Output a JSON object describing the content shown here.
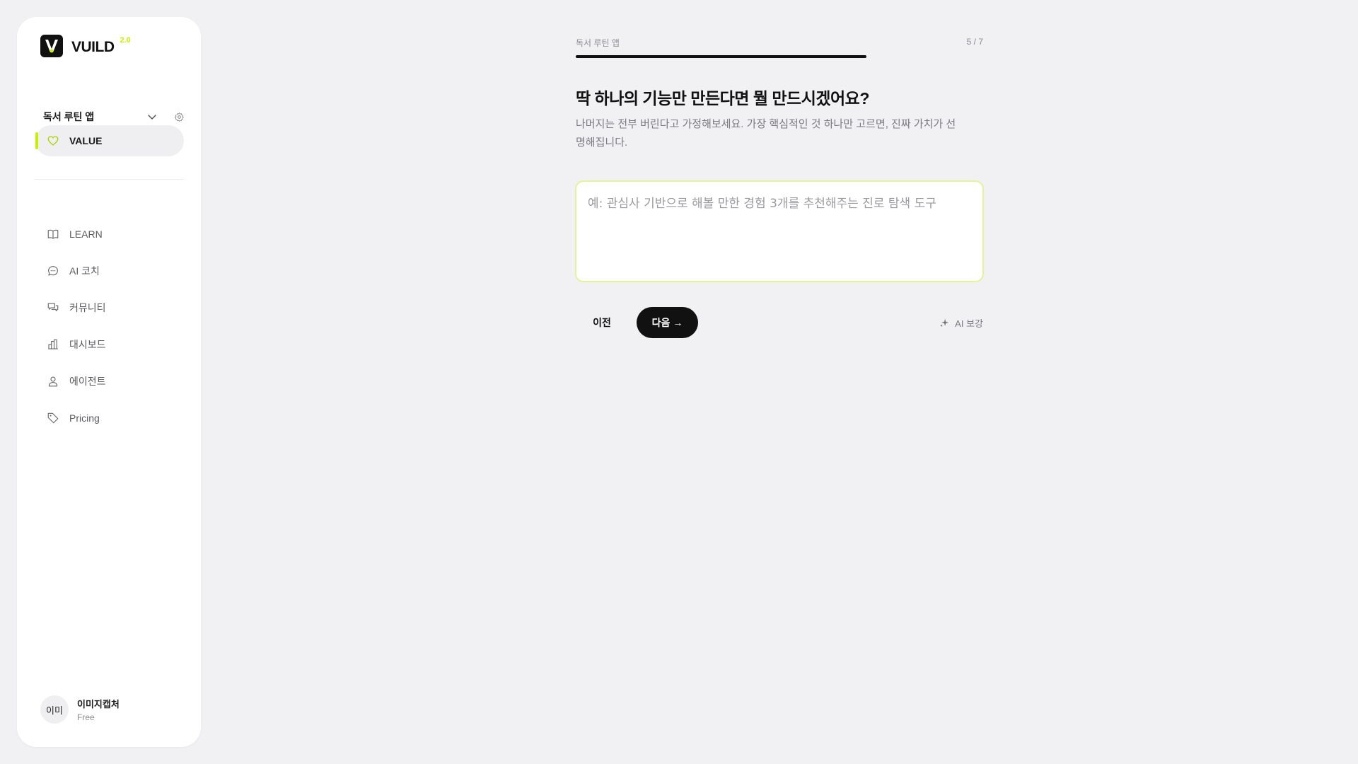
{
  "colors": {
    "accent": "#c8f000",
    "background": "#f1f1f3",
    "primary_button": "#111111"
  },
  "sidebar": {
    "logo_text": "VUILD",
    "version": "2.0",
    "project": {
      "name": "독서 루틴 앱",
      "chevron_icon": "chevron-down-icon",
      "settings_icon": "gear-icon"
    },
    "active_item": {
      "label": "VALUE",
      "icon": "heart-icon"
    },
    "items": [
      {
        "label": "LEARN",
        "icon": "book-icon"
      },
      {
        "label": "AI 코치",
        "icon": "chat-bubble-icon"
      },
      {
        "label": "커뮤니티",
        "icon": "community-chat-icon"
      },
      {
        "label": "대시보드",
        "icon": "bar-chart-icon"
      },
      {
        "label": "에이전트",
        "icon": "person-icon"
      },
      {
        "label": "Pricing",
        "icon": "tag-icon"
      }
    ],
    "user": {
      "avatar_text": "이미",
      "name": "이미지캡처",
      "plan": "Free"
    }
  },
  "main": {
    "breadcrumb": "독서 루틴 앱",
    "step_counter": "5 / 7",
    "progress": 0.714,
    "question": "딱 하나의 기능만 만든다면 뭘 만드시겠어요?",
    "subtitle": "나머지는 전부 버린다고 가정해보세요. 가장 핵심적인 것 하나만 고르면, 진짜 가치가 선명해집니다.",
    "answer": {
      "value": "",
      "placeholder": "예: 관심사 기반으로 해볼 만한 경험 3개를 추천해주는 진로 탐색 도구"
    },
    "prev_label": "이전",
    "next_label": "다음 →",
    "ai_boost_label": "AI 보강",
    "ai_boost_icon": "sparkle-icon"
  }
}
